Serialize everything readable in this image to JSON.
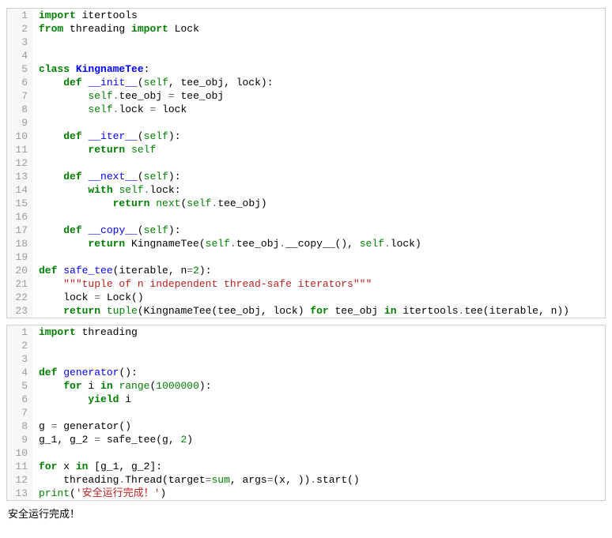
{
  "blocks": [
    {
      "lines": [
        [
          {
            "c": "kw",
            "t": "import"
          },
          {
            "c": "plain",
            "t": " itertools"
          }
        ],
        [
          {
            "c": "kw",
            "t": "from"
          },
          {
            "c": "plain",
            "t": " threading "
          },
          {
            "c": "kw",
            "t": "import"
          },
          {
            "c": "plain",
            "t": " Lock"
          }
        ],
        [],
        [],
        [
          {
            "c": "kw",
            "t": "class"
          },
          {
            "c": "plain",
            "t": " "
          },
          {
            "c": "cls",
            "t": "KingnameTee"
          },
          {
            "c": "plain",
            "t": ":"
          }
        ],
        [
          {
            "c": "plain",
            "t": "    "
          },
          {
            "c": "kw",
            "t": "def"
          },
          {
            "c": "plain",
            "t": " "
          },
          {
            "c": "fn",
            "t": "__init__"
          },
          {
            "c": "plain",
            "t": "("
          },
          {
            "c": "bi",
            "t": "self"
          },
          {
            "c": "plain",
            "t": ", tee_obj, lock):"
          }
        ],
        [
          {
            "c": "plain",
            "t": "        "
          },
          {
            "c": "bi",
            "t": "self"
          },
          {
            "c": "op",
            "t": "."
          },
          {
            "c": "plain",
            "t": "tee_obj "
          },
          {
            "c": "op",
            "t": "="
          },
          {
            "c": "plain",
            "t": " tee_obj"
          }
        ],
        [
          {
            "c": "plain",
            "t": "        "
          },
          {
            "c": "bi",
            "t": "self"
          },
          {
            "c": "op",
            "t": "."
          },
          {
            "c": "plain",
            "t": "lock "
          },
          {
            "c": "op",
            "t": "="
          },
          {
            "c": "plain",
            "t": " lock"
          }
        ],
        [],
        [
          {
            "c": "plain",
            "t": "    "
          },
          {
            "c": "kw",
            "t": "def"
          },
          {
            "c": "plain",
            "t": " "
          },
          {
            "c": "fn",
            "t": "__iter__"
          },
          {
            "c": "plain",
            "t": "("
          },
          {
            "c": "bi",
            "t": "self"
          },
          {
            "c": "plain",
            "t": "):"
          }
        ],
        [
          {
            "c": "plain",
            "t": "        "
          },
          {
            "c": "kw",
            "t": "return"
          },
          {
            "c": "plain",
            "t": " "
          },
          {
            "c": "bi",
            "t": "self"
          }
        ],
        [],
        [
          {
            "c": "plain",
            "t": "    "
          },
          {
            "c": "kw",
            "t": "def"
          },
          {
            "c": "plain",
            "t": " "
          },
          {
            "c": "fn",
            "t": "__next__"
          },
          {
            "c": "plain",
            "t": "("
          },
          {
            "c": "bi",
            "t": "self"
          },
          {
            "c": "plain",
            "t": "):"
          }
        ],
        [
          {
            "c": "plain",
            "t": "        "
          },
          {
            "c": "kw",
            "t": "with"
          },
          {
            "c": "plain",
            "t": " "
          },
          {
            "c": "bi",
            "t": "self"
          },
          {
            "c": "op",
            "t": "."
          },
          {
            "c": "plain",
            "t": "lock:"
          }
        ],
        [
          {
            "c": "plain",
            "t": "            "
          },
          {
            "c": "kw",
            "t": "return"
          },
          {
            "c": "plain",
            "t": " "
          },
          {
            "c": "bi",
            "t": "next"
          },
          {
            "c": "plain",
            "t": "("
          },
          {
            "c": "bi",
            "t": "self"
          },
          {
            "c": "op",
            "t": "."
          },
          {
            "c": "plain",
            "t": "tee_obj)"
          }
        ],
        [],
        [
          {
            "c": "plain",
            "t": "    "
          },
          {
            "c": "kw",
            "t": "def"
          },
          {
            "c": "plain",
            "t": " "
          },
          {
            "c": "fn",
            "t": "__copy__"
          },
          {
            "c": "plain",
            "t": "("
          },
          {
            "c": "bi",
            "t": "self"
          },
          {
            "c": "plain",
            "t": "):"
          }
        ],
        [
          {
            "c": "plain",
            "t": "        "
          },
          {
            "c": "kw",
            "t": "return"
          },
          {
            "c": "plain",
            "t": " KingnameTee("
          },
          {
            "c": "bi",
            "t": "self"
          },
          {
            "c": "op",
            "t": "."
          },
          {
            "c": "plain",
            "t": "tee_obj"
          },
          {
            "c": "op",
            "t": "."
          },
          {
            "c": "plain",
            "t": "__copy__(), "
          },
          {
            "c": "bi",
            "t": "self"
          },
          {
            "c": "op",
            "t": "."
          },
          {
            "c": "plain",
            "t": "lock)"
          }
        ],
        [],
        [
          {
            "c": "kw",
            "t": "def"
          },
          {
            "c": "plain",
            "t": " "
          },
          {
            "c": "fn",
            "t": "safe_tee"
          },
          {
            "c": "plain",
            "t": "(iterable, n"
          },
          {
            "c": "op",
            "t": "="
          },
          {
            "c": "num",
            "t": "2"
          },
          {
            "c": "plain",
            "t": "):"
          }
        ],
        [
          {
            "c": "plain",
            "t": "    "
          },
          {
            "c": "str",
            "t": "\"\"\"tuple of n independent thread-safe iterators\"\"\""
          }
        ],
        [
          {
            "c": "plain",
            "t": "    lock "
          },
          {
            "c": "op",
            "t": "="
          },
          {
            "c": "plain",
            "t": " Lock()"
          }
        ],
        [
          {
            "c": "plain",
            "t": "    "
          },
          {
            "c": "kw",
            "t": "return"
          },
          {
            "c": "plain",
            "t": " "
          },
          {
            "c": "bi",
            "t": "tuple"
          },
          {
            "c": "plain",
            "t": "(KingnameTee(tee_obj, lock) "
          },
          {
            "c": "kw",
            "t": "for"
          },
          {
            "c": "plain",
            "t": " tee_obj "
          },
          {
            "c": "kw",
            "t": "in"
          },
          {
            "c": "plain",
            "t": " itertools"
          },
          {
            "c": "op",
            "t": "."
          },
          {
            "c": "plain",
            "t": "tee(iterable, n))"
          }
        ]
      ]
    },
    {
      "lines": [
        [
          {
            "c": "kw",
            "t": "import"
          },
          {
            "c": "plain",
            "t": " threading"
          }
        ],
        [],
        [],
        [
          {
            "c": "kw",
            "t": "def"
          },
          {
            "c": "plain",
            "t": " "
          },
          {
            "c": "fn",
            "t": "generator"
          },
          {
            "c": "plain",
            "t": "():"
          }
        ],
        [
          {
            "c": "plain",
            "t": "    "
          },
          {
            "c": "kw",
            "t": "for"
          },
          {
            "c": "plain",
            "t": " i "
          },
          {
            "c": "kw",
            "t": "in"
          },
          {
            "c": "plain",
            "t": " "
          },
          {
            "c": "bi",
            "t": "range"
          },
          {
            "c": "plain",
            "t": "("
          },
          {
            "c": "num",
            "t": "1000000"
          },
          {
            "c": "plain",
            "t": "):"
          }
        ],
        [
          {
            "c": "plain",
            "t": "        "
          },
          {
            "c": "kw",
            "t": "yield"
          },
          {
            "c": "plain",
            "t": " i"
          }
        ],
        [],
        [
          {
            "c": "plain",
            "t": "g "
          },
          {
            "c": "op",
            "t": "="
          },
          {
            "c": "plain",
            "t": " generator()"
          }
        ],
        [
          {
            "c": "plain",
            "t": "g_1, g_2 "
          },
          {
            "c": "op",
            "t": "="
          },
          {
            "c": "plain",
            "t": " safe_tee(g, "
          },
          {
            "c": "num",
            "t": "2"
          },
          {
            "c": "plain",
            "t": ")"
          }
        ],
        [],
        [
          {
            "c": "kw",
            "t": "for"
          },
          {
            "c": "plain",
            "t": " x "
          },
          {
            "c": "kw",
            "t": "in"
          },
          {
            "c": "plain",
            "t": " [g_1, g_2]:"
          }
        ],
        [
          {
            "c": "plain",
            "t": "    threading"
          },
          {
            "c": "op",
            "t": "."
          },
          {
            "c": "plain",
            "t": "Thread(target"
          },
          {
            "c": "op",
            "t": "="
          },
          {
            "c": "bi",
            "t": "sum"
          },
          {
            "c": "plain",
            "t": ", args"
          },
          {
            "c": "op",
            "t": "="
          },
          {
            "c": "plain",
            "t": "(x, ))"
          },
          {
            "c": "op",
            "t": "."
          },
          {
            "c": "plain",
            "t": "start()"
          }
        ],
        [
          {
            "c": "bi",
            "t": "print"
          },
          {
            "c": "plain",
            "t": "("
          },
          {
            "c": "str",
            "t": "'安全运行完成！'"
          },
          {
            "c": "plain",
            "t": ")"
          }
        ]
      ]
    }
  ],
  "output": "安全运行完成！"
}
